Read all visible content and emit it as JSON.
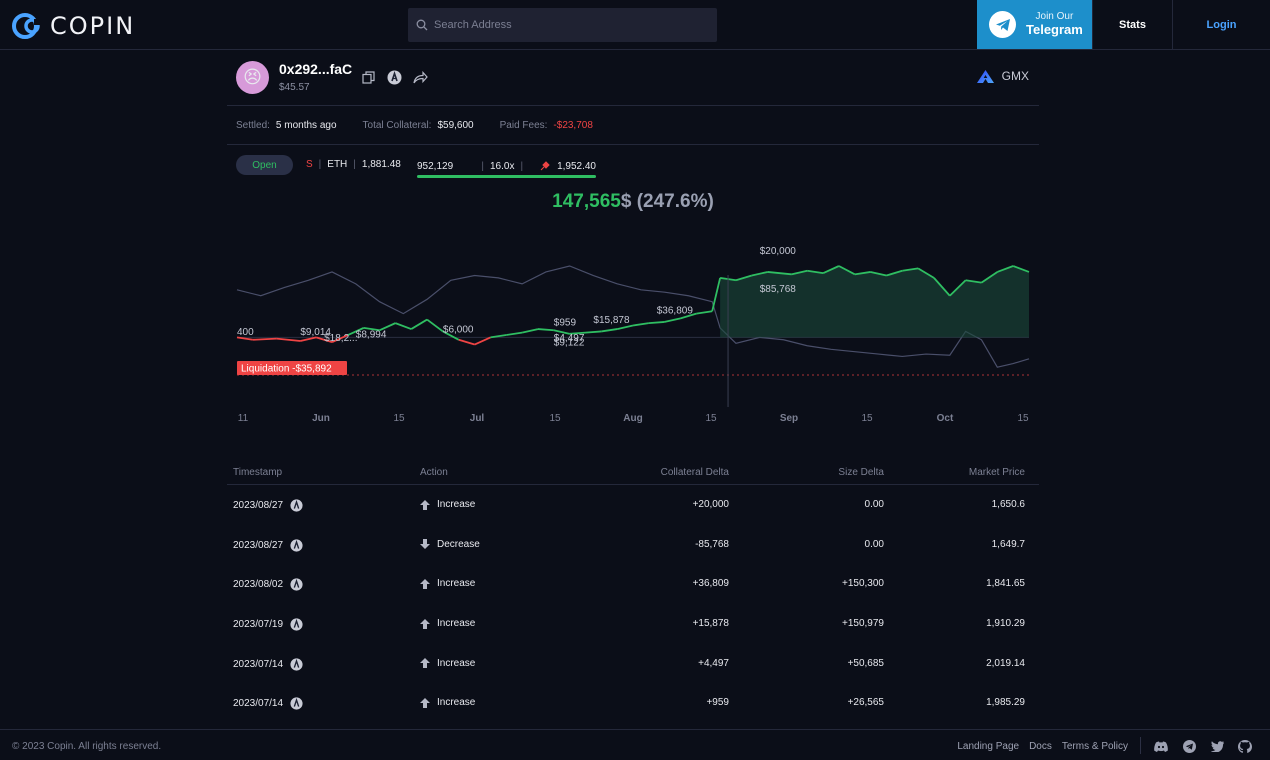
{
  "header": {
    "logo_text": "COPIN",
    "search_placeholder": "Search Address",
    "telegram_small": "Join Our",
    "telegram_big": "Telegram",
    "nav_stats": "Stats",
    "nav_login": "Login"
  },
  "trader": {
    "avatar_emoji": "😣",
    "address": "0x292...faC",
    "balance": "$45.57",
    "protocol": "GMX"
  },
  "stats": {
    "settled_label": "Settled:",
    "settled_value": "5 months ago",
    "collateral_label": "Total Collateral:",
    "collateral_value": "$59,600",
    "fees_label": "Paid Fees:",
    "fees_value": "-$23,708"
  },
  "position": {
    "status": "Open",
    "side": "S",
    "token": "ETH",
    "entry": "1,881.48",
    "size": "952,129",
    "leverage": "16.0x",
    "liq_price": "1,952.40"
  },
  "pnl": {
    "value": "147,565",
    "currency": "$",
    "percent": "(247.6%)"
  },
  "chart_data": {
    "type": "line",
    "x_ticks": [
      "11",
      "Jun",
      "15",
      "Jul",
      "15",
      "Aug",
      "15",
      "Sep",
      "15",
      "Oct",
      "15"
    ],
    "liquidation_label": "Liquidation -$35,892",
    "annotations": [
      "400",
      "$9,014",
      "$18,2...",
      "$8,994",
      "$6,000",
      "$959",
      "$4,497",
      "$9,122",
      "$15,878",
      "$36,809",
      "$20,000",
      "$85,768"
    ],
    "pnl_series": [
      [
        0,
        0.4
      ],
      [
        0.02,
        0.38
      ],
      [
        0.05,
        0.39
      ],
      [
        0.08,
        0.37
      ],
      [
        0.1,
        0.4
      ],
      [
        0.12,
        0.36
      ],
      [
        0.14,
        0.42
      ],
      [
        0.16,
        0.48
      ],
      [
        0.18,
        0.46
      ],
      [
        0.2,
        0.52
      ],
      [
        0.22,
        0.47
      ],
      [
        0.24,
        0.55
      ],
      [
        0.26,
        0.45
      ],
      [
        0.28,
        0.38
      ],
      [
        0.3,
        0.34
      ],
      [
        0.32,
        0.4
      ],
      [
        0.34,
        0.42
      ],
      [
        0.36,
        0.44
      ],
      [
        0.38,
        0.47
      ],
      [
        0.4,
        0.46
      ],
      [
        0.42,
        0.43
      ],
      [
        0.44,
        0.44
      ],
      [
        0.46,
        0.45
      ],
      [
        0.48,
        0.47
      ],
      [
        0.5,
        0.5
      ],
      [
        0.52,
        0.52
      ],
      [
        0.54,
        0.53
      ],
      [
        0.56,
        0.56
      ],
      [
        0.58,
        0.6
      ],
      [
        0.6,
        0.62
      ],
      [
        0.61,
        0.9
      ],
      [
        0.63,
        0.88
      ],
      [
        0.65,
        0.92
      ],
      [
        0.67,
        0.95
      ],
      [
        0.7,
        0.93
      ],
      [
        0.72,
        0.96
      ],
      [
        0.74,
        0.94
      ],
      [
        0.76,
        1.0
      ],
      [
        0.78,
        0.93
      ],
      [
        0.8,
        0.95
      ],
      [
        0.82,
        0.92
      ],
      [
        0.84,
        0.96
      ],
      [
        0.86,
        0.98
      ],
      [
        0.88,
        0.9
      ],
      [
        0.9,
        0.75
      ],
      [
        0.92,
        0.88
      ],
      [
        0.94,
        0.86
      ],
      [
        0.96,
        0.95
      ],
      [
        0.98,
        1.0
      ],
      [
        1.0,
        0.95
      ]
    ],
    "price_series": [
      [
        0,
        0.8
      ],
      [
        0.03,
        0.75
      ],
      [
        0.06,
        0.82
      ],
      [
        0.09,
        0.88
      ],
      [
        0.12,
        0.95
      ],
      [
        0.15,
        0.85
      ],
      [
        0.18,
        0.7
      ],
      [
        0.21,
        0.6
      ],
      [
        0.24,
        0.72
      ],
      [
        0.27,
        0.88
      ],
      [
        0.3,
        0.92
      ],
      [
        0.33,
        0.9
      ],
      [
        0.36,
        0.85
      ],
      [
        0.39,
        0.95
      ],
      [
        0.42,
        1.0
      ],
      [
        0.45,
        0.92
      ],
      [
        0.48,
        0.85
      ],
      [
        0.51,
        0.8
      ],
      [
        0.54,
        0.78
      ],
      [
        0.57,
        0.75
      ],
      [
        0.6,
        0.7
      ],
      [
        0.61,
        0.48
      ],
      [
        0.63,
        0.35
      ],
      [
        0.66,
        0.4
      ],
      [
        0.69,
        0.38
      ],
      [
        0.72,
        0.33
      ],
      [
        0.75,
        0.3
      ],
      [
        0.78,
        0.28
      ],
      [
        0.81,
        0.26
      ],
      [
        0.84,
        0.24
      ],
      [
        0.87,
        0.26
      ],
      [
        0.9,
        0.25
      ],
      [
        0.92,
        0.45
      ],
      [
        0.94,
        0.38
      ],
      [
        0.96,
        0.15
      ],
      [
        0.98,
        0.18
      ],
      [
        1.0,
        0.22
      ]
    ]
  },
  "table": {
    "headers": {
      "timestamp": "Timestamp",
      "action": "Action",
      "collateral": "Collateral Delta",
      "size": "Size Delta",
      "price": "Market Price"
    },
    "rows": [
      {
        "date": "2023/08/27",
        "action": "Increase",
        "dir": "up",
        "collateral": "+20,000",
        "size": "0.00",
        "price": "1,650.6"
      },
      {
        "date": "2023/08/27",
        "action": "Decrease",
        "dir": "down",
        "collateral": "-85,768",
        "size": "0.00",
        "price": "1,649.7"
      },
      {
        "date": "2023/08/02",
        "action": "Increase",
        "dir": "up",
        "collateral": "+36,809",
        "size": "+150,300",
        "price": "1,841.65"
      },
      {
        "date": "2023/07/19",
        "action": "Increase",
        "dir": "up",
        "collateral": "+15,878",
        "size": "+150,979",
        "price": "1,910.29"
      },
      {
        "date": "2023/07/14",
        "action": "Increase",
        "dir": "up",
        "collateral": "+4,497",
        "size": "+50,685",
        "price": "2,019.14"
      },
      {
        "date": "2023/07/14",
        "action": "Increase",
        "dir": "up",
        "collateral": "+959",
        "size": "+26,565",
        "price": "1,985.29"
      }
    ]
  },
  "footer": {
    "copyright": "© 2023 Copin. All rights reserved.",
    "links": [
      "Landing Page",
      "Docs",
      "Terms & Policy"
    ]
  },
  "colors": {
    "profit": "#2fbe62",
    "loss": "#ef4444",
    "accent": "#1d8fcb",
    "link": "#4aa3ff"
  }
}
